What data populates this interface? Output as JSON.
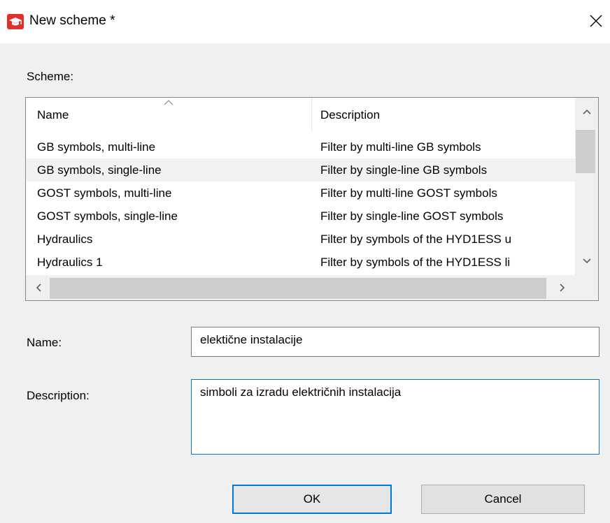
{
  "window": {
    "title": "New scheme *",
    "close_icon": "close-icon",
    "app_icon": "graduation-cap-icon",
    "accent_color": "#e0302b"
  },
  "scheme": {
    "label": "Scheme:",
    "columns": [
      {
        "label": "Name",
        "sorted": "ascending"
      },
      {
        "label": "Description"
      }
    ],
    "rows": [
      {
        "name": "GB symbols, multi-line",
        "description": "Filter by multi-line GB symbols",
        "selected": false
      },
      {
        "name": "GB symbols, single-line",
        "description": "Filter by single-line GB symbols",
        "selected": true
      },
      {
        "name": "GOST symbols, multi-line",
        "description": "Filter by multi-line GOST symbols",
        "selected": false
      },
      {
        "name": "GOST symbols, single-line",
        "description": "Filter by single-line GOST symbols",
        "selected": false
      },
      {
        "name": "Hydraulics",
        "description": "Filter by symbols of the HYD1ESS u",
        "selected": false
      },
      {
        "name": "Hydraulics 1",
        "description": "Filter by symbols of the HYD1ESS li",
        "selected": false
      }
    ]
  },
  "form": {
    "name_label": "Name:",
    "name_value": "elektične instalacije",
    "description_label": "Description:",
    "description_value": "simboli za izradu električnih instalacija"
  },
  "buttons": {
    "ok": "OK",
    "cancel": "Cancel"
  }
}
